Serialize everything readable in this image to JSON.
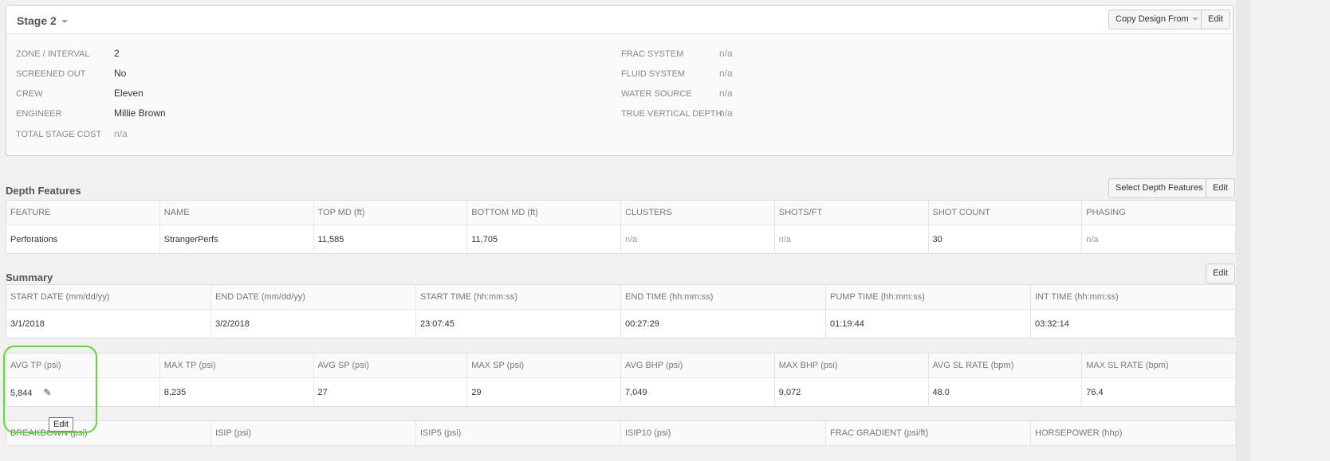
{
  "stage": {
    "title": "Stage 2",
    "copy_label": "Copy Design From",
    "edit_label": "Edit",
    "left": [
      {
        "label": "ZONE / INTERVAL",
        "value": "2"
      },
      {
        "label": "SCREENED OUT",
        "value": "No"
      },
      {
        "label": "CREW",
        "value": "Eleven"
      },
      {
        "label": "ENGINEER",
        "value": "Millie Brown"
      },
      {
        "label": "TOTAL STAGE COST",
        "value": "n/a"
      }
    ],
    "right": [
      {
        "label": "FRAC SYSTEM",
        "value": "n/a"
      },
      {
        "label": "FLUID SYSTEM",
        "value": "n/a"
      },
      {
        "label": "WATER SOURCE",
        "value": "n/a"
      },
      {
        "label": "TRUE VERTICAL DEPTH",
        "value": "n/a"
      }
    ]
  },
  "depth": {
    "title": "Depth Features",
    "select_label": "Select Depth Features",
    "edit_label": "Edit",
    "headers": [
      "FEATURE",
      "NAME",
      "TOP MD (ft)",
      "BOTTOM MD (ft)",
      "CLUSTERS",
      "SHOTS/FT",
      "SHOT COUNT",
      "PHASING"
    ],
    "row": [
      "Perforations",
      "StrangerPerfs",
      "11,585",
      "11,705",
      "n/a",
      "n/a",
      "30",
      "n/a"
    ]
  },
  "summary": {
    "title": "Summary",
    "edit_label": "Edit",
    "headers1": [
      "START DATE (mm/dd/yy)",
      "END DATE (mm/dd/yy)",
      "START TIME (hh:mm:ss)",
      "END TIME (hh:mm:ss)",
      "PUMP TIME (hh:mm:ss)",
      "INT TIME (hh:mm:ss)"
    ],
    "row1": [
      "3/1/2018",
      "3/2/2018",
      "23:07:45",
      "00:27:29",
      "01:19:44",
      "03:32:14"
    ],
    "headers2": [
      "AVG TP (psi)",
      "MAX TP (psi)",
      "AVG SP (psi)",
      "MAX SP (psi)",
      "AVG BHP (psi)",
      "MAX BHP (psi)",
      "AVG SL RATE (bpm)",
      "MAX SL RATE (bpm)"
    ],
    "row2": [
      "5,844",
      "8,235",
      "27",
      "29",
      "7,049",
      "9,072",
      "48.0",
      "76.4"
    ],
    "headers3": [
      "BREAKDOWN (psi)",
      "ISIP (psi)",
      "ISIP5 (psi)",
      "ISIP10 (psi)",
      "FRAC GRADIENT (psi/ft)",
      "HORSEPOWER (hhp)"
    ]
  },
  "tooltip": "Edit"
}
